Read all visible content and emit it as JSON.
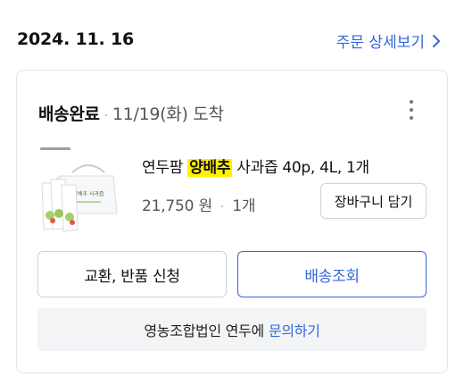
{
  "order": {
    "date": "2024. 11. 16",
    "detail_link_label": "주문 상세보기"
  },
  "delivery": {
    "status": "배송완료",
    "separator": "·",
    "arrival": "11/19(화) 도착"
  },
  "product": {
    "name_prefix": "연두팜",
    "name_highlight": "양배추",
    "name_suffix": "사과즙 40p, 4L, 1개",
    "price": "21,750 원",
    "separator": "·",
    "quantity": "1개",
    "cart_button_label": "장바구니 담기",
    "thumbnail": {
      "box_text": "양배추 사과즙",
      "brand_text": "YEONDOOFARM"
    }
  },
  "actions": {
    "exchange_label": "교환, 반품 신청",
    "track_label": "배송조회"
  },
  "seller": {
    "name": "영농조합법인 연두에",
    "inquiry_label": "문의하기"
  },
  "colors": {
    "accent": "#3467d9",
    "highlight": "#fff200",
    "border": "#cfd3d8",
    "inquiry_bg": "#f3f4f6"
  },
  "icons": {
    "detail_link": "chevron-right-icon",
    "more": "more-vertical-icon"
  }
}
